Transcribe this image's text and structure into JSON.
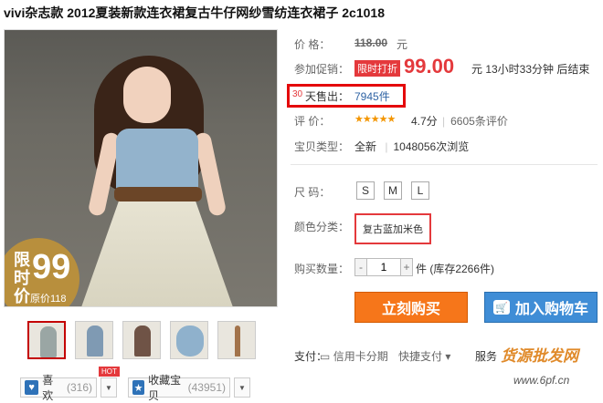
{
  "title": "vivi杂志款 2012夏装新款连衣裙复古牛仔网纱雪纺连衣裙子 2c1018",
  "image": {
    "promo_label": "限时价",
    "promo_price": "99",
    "promo_original": "原价118"
  },
  "price": {
    "label": "价    格：",
    "original": "118.00",
    "unit": "元"
  },
  "promotion": {
    "label": "参加促销：",
    "tag": "限时打折",
    "price": "99.00",
    "tail": "元 13小时33分钟 后结束"
  },
  "sales": {
    "days": "30",
    "label": "天售出：",
    "value": "7945件"
  },
  "rating": {
    "label": "评    价：",
    "stars": "★★★★★",
    "score": "4.7分",
    "sep": "|",
    "reviews": "6605条评价"
  },
  "condition": {
    "label": "宝贝类型：",
    "value": "全新",
    "sep": "|",
    "views": "1048056次浏览"
  },
  "size": {
    "label": "尺    码：",
    "options": [
      "S",
      "M",
      "L"
    ]
  },
  "color": {
    "label": "颜色分类：",
    "option": "复古蓝加米色"
  },
  "quantity": {
    "label": "购买数量：",
    "minus": "-",
    "value": "1",
    "plus": "+",
    "stock": "件 (库存2266件)"
  },
  "buttons": {
    "buy": "立刻购买",
    "cart": "加入购物车"
  },
  "payment": {
    "label": "支付：",
    "card": "信用卡分期",
    "quick": "快捷支付",
    "service": "服务"
  },
  "actions": {
    "like": "喜欢",
    "like_count": "(316)",
    "hot": "HOT",
    "favorite": "收藏宝贝",
    "favorite_count": "(43951)"
  },
  "watermark": {
    "text": "货源批发网",
    "url": "www.6pf.cn"
  },
  "colors": {
    "accent_red": "#e4393c",
    "buy_orange": "#f6761a",
    "cart_blue": "#3f8dd6",
    "star_orange": "#f39500"
  }
}
